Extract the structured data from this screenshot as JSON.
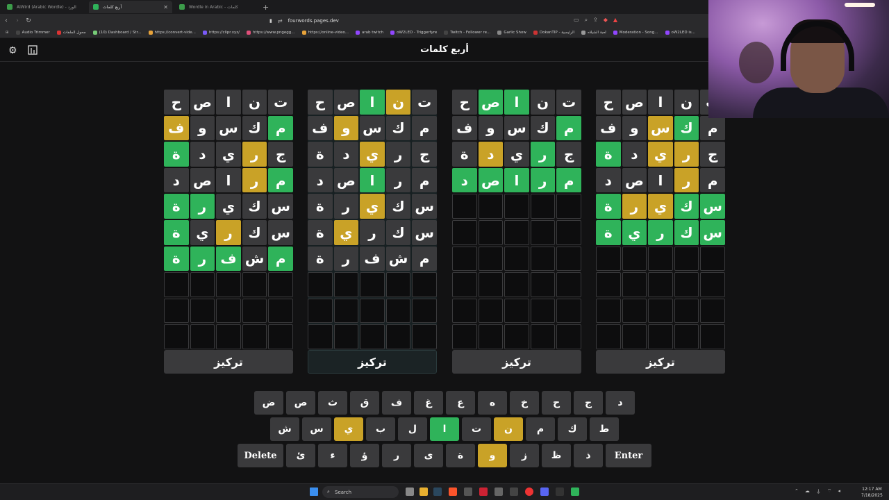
{
  "browser": {
    "tabs": [
      {
        "title": "AlWird (Arabic Wordle) - الورد"
      },
      {
        "title": "أربع كلمات",
        "active": true
      },
      {
        "title": "Wordle in Arabic - كلمات"
      }
    ],
    "url": "fourwords.pages.dev",
    "bookmarks": [
      "Audio Trimmer",
      "محول الملفات",
      "(10) Dashboard / Str...",
      "https://convert-vide...",
      "https://clipr.xyz/",
      "https://www.pngegg...",
      "https://online-video...",
      "arab twitch",
      "oW2LED - Triggerfyre",
      "Twitch - Follower re...",
      "Garlic Show",
      "DokanTIP - الرئيسية",
      "لعبة الشيلاه",
      "Moderation - Song...",
      "oW2LED is..."
    ]
  },
  "app": {
    "title": "أربع كلمات",
    "focus_label": "تركيز"
  },
  "colors": {
    "green": "#2fb35a",
    "yellow": "#c9a227",
    "dark": "#3a3a3c",
    "empty": "#0d0d0e"
  },
  "boards": [
    {
      "rows": [
        [
          {
            "l": "ح",
            "s": "d"
          },
          {
            "l": "ص",
            "s": "d"
          },
          {
            "l": "ا",
            "s": "d"
          },
          {
            "l": "ن",
            "s": "d"
          },
          {
            "l": "ت",
            "s": "d"
          }
        ],
        [
          {
            "l": "ف",
            "s": "y"
          },
          {
            "l": "و",
            "s": "d"
          },
          {
            "l": "س",
            "s": "d"
          },
          {
            "l": "ك",
            "s": "d"
          },
          {
            "l": "م",
            "s": "g"
          }
        ],
        [
          {
            "l": "ة",
            "s": "g"
          },
          {
            "l": "د",
            "s": "d"
          },
          {
            "l": "ي",
            "s": "d"
          },
          {
            "l": "ر",
            "s": "y"
          },
          {
            "l": "ج",
            "s": "d"
          }
        ],
        [
          {
            "l": "د",
            "s": "d"
          },
          {
            "l": "ص",
            "s": "d"
          },
          {
            "l": "ا",
            "s": "d"
          },
          {
            "l": "ر",
            "s": "y"
          },
          {
            "l": "م",
            "s": "g"
          }
        ],
        [
          {
            "l": "ة",
            "s": "g"
          },
          {
            "l": "ر",
            "s": "g"
          },
          {
            "l": "ي",
            "s": "d"
          },
          {
            "l": "ك",
            "s": "d"
          },
          {
            "l": "س",
            "s": "d"
          }
        ],
        [
          {
            "l": "ة",
            "s": "g"
          },
          {
            "l": "ي",
            "s": "d"
          },
          {
            "l": "ر",
            "s": "y"
          },
          {
            "l": "ك",
            "s": "d"
          },
          {
            "l": "س",
            "s": "d"
          }
        ],
        [
          {
            "l": "ة",
            "s": "g"
          },
          {
            "l": "ر",
            "s": "g"
          },
          {
            "l": "ف",
            "s": "g"
          },
          {
            "l": "ش",
            "s": "d"
          },
          {
            "l": "م",
            "s": "g"
          }
        ],
        [
          {
            "l": "",
            "s": "e"
          },
          {
            "l": "",
            "s": "e"
          },
          {
            "l": "",
            "s": "e"
          },
          {
            "l": "",
            "s": "e"
          },
          {
            "l": "",
            "s": "e"
          }
        ],
        [
          {
            "l": "",
            "s": "e"
          },
          {
            "l": "",
            "s": "e"
          },
          {
            "l": "",
            "s": "e"
          },
          {
            "l": "",
            "s": "e"
          },
          {
            "l": "",
            "s": "e"
          }
        ],
        [
          {
            "l": "",
            "s": "e"
          },
          {
            "l": "",
            "s": "e"
          },
          {
            "l": "",
            "s": "e"
          },
          {
            "l": "",
            "s": "e"
          },
          {
            "l": "",
            "s": "e"
          }
        ]
      ]
    },
    {
      "rows": [
        [
          {
            "l": "ح",
            "s": "d"
          },
          {
            "l": "ص",
            "s": "d"
          },
          {
            "l": "ا",
            "s": "g"
          },
          {
            "l": "ن",
            "s": "y"
          },
          {
            "l": "ت",
            "s": "d"
          }
        ],
        [
          {
            "l": "ف",
            "s": "d"
          },
          {
            "l": "و",
            "s": "y"
          },
          {
            "l": "س",
            "s": "d"
          },
          {
            "l": "ك",
            "s": "d"
          },
          {
            "l": "م",
            "s": "d"
          }
        ],
        [
          {
            "l": "ة",
            "s": "d"
          },
          {
            "l": "د",
            "s": "d"
          },
          {
            "l": "ي",
            "s": "y"
          },
          {
            "l": "ر",
            "s": "d"
          },
          {
            "l": "ج",
            "s": "d"
          }
        ],
        [
          {
            "l": "د",
            "s": "d"
          },
          {
            "l": "ص",
            "s": "d"
          },
          {
            "l": "ا",
            "s": "g"
          },
          {
            "l": "ر",
            "s": "d"
          },
          {
            "l": "م",
            "s": "d"
          }
        ],
        [
          {
            "l": "ة",
            "s": "d"
          },
          {
            "l": "ر",
            "s": "d"
          },
          {
            "l": "ي",
            "s": "y"
          },
          {
            "l": "ك",
            "s": "d"
          },
          {
            "l": "س",
            "s": "d"
          }
        ],
        [
          {
            "l": "ة",
            "s": "d"
          },
          {
            "l": "ي",
            "s": "y"
          },
          {
            "l": "ر",
            "s": "d"
          },
          {
            "l": "ك",
            "s": "d"
          },
          {
            "l": "س",
            "s": "d"
          }
        ],
        [
          {
            "l": "ة",
            "s": "d"
          },
          {
            "l": "ر",
            "s": "d"
          },
          {
            "l": "ف",
            "s": "d"
          },
          {
            "l": "ش",
            "s": "d"
          },
          {
            "l": "م",
            "s": "d"
          }
        ],
        [
          {
            "l": "",
            "s": "e"
          },
          {
            "l": "",
            "s": "e"
          },
          {
            "l": "",
            "s": "e"
          },
          {
            "l": "",
            "s": "e"
          },
          {
            "l": "",
            "s": "e"
          }
        ],
        [
          {
            "l": "",
            "s": "e"
          },
          {
            "l": "",
            "s": "e"
          },
          {
            "l": "",
            "s": "e"
          },
          {
            "l": "",
            "s": "e"
          },
          {
            "l": "",
            "s": "e"
          }
        ],
        [
          {
            "l": "",
            "s": "e"
          },
          {
            "l": "",
            "s": "e"
          },
          {
            "l": "",
            "s": "e"
          },
          {
            "l": "",
            "s": "e"
          },
          {
            "l": "",
            "s": "e"
          }
        ]
      ]
    },
    {
      "rows": [
        [
          {
            "l": "ح",
            "s": "d"
          },
          {
            "l": "ص",
            "s": "g"
          },
          {
            "l": "ا",
            "s": "g"
          },
          {
            "l": "ن",
            "s": "d"
          },
          {
            "l": "ت",
            "s": "d"
          }
        ],
        [
          {
            "l": "ف",
            "s": "d"
          },
          {
            "l": "و",
            "s": "d"
          },
          {
            "l": "س",
            "s": "d"
          },
          {
            "l": "ك",
            "s": "d"
          },
          {
            "l": "م",
            "s": "g"
          }
        ],
        [
          {
            "l": "ة",
            "s": "d"
          },
          {
            "l": "د",
            "s": "y"
          },
          {
            "l": "ي",
            "s": "d"
          },
          {
            "l": "ر",
            "s": "g"
          },
          {
            "l": "ج",
            "s": "d"
          }
        ],
        [
          {
            "l": "د",
            "s": "g"
          },
          {
            "l": "ص",
            "s": "g"
          },
          {
            "l": "ا",
            "s": "g"
          },
          {
            "l": "ر",
            "s": "g"
          },
          {
            "l": "م",
            "s": "g"
          }
        ],
        [
          {
            "l": "",
            "s": "e"
          },
          {
            "l": "",
            "s": "e"
          },
          {
            "l": "",
            "s": "e"
          },
          {
            "l": "",
            "s": "e"
          },
          {
            "l": "",
            "s": "e"
          }
        ],
        [
          {
            "l": "",
            "s": "e"
          },
          {
            "l": "",
            "s": "e"
          },
          {
            "l": "",
            "s": "e"
          },
          {
            "l": "",
            "s": "e"
          },
          {
            "l": "",
            "s": "e"
          }
        ],
        [
          {
            "l": "",
            "s": "e"
          },
          {
            "l": "",
            "s": "e"
          },
          {
            "l": "",
            "s": "e"
          },
          {
            "l": "",
            "s": "e"
          },
          {
            "l": "",
            "s": "e"
          }
        ],
        [
          {
            "l": "",
            "s": "e"
          },
          {
            "l": "",
            "s": "e"
          },
          {
            "l": "",
            "s": "e"
          },
          {
            "l": "",
            "s": "e"
          },
          {
            "l": "",
            "s": "e"
          }
        ],
        [
          {
            "l": "",
            "s": "e"
          },
          {
            "l": "",
            "s": "e"
          },
          {
            "l": "",
            "s": "e"
          },
          {
            "l": "",
            "s": "e"
          },
          {
            "l": "",
            "s": "e"
          }
        ],
        [
          {
            "l": "",
            "s": "e"
          },
          {
            "l": "",
            "s": "e"
          },
          {
            "l": "",
            "s": "e"
          },
          {
            "l": "",
            "s": "e"
          },
          {
            "l": "",
            "s": "e"
          }
        ]
      ]
    },
    {
      "rows": [
        [
          {
            "l": "ح",
            "s": "d"
          },
          {
            "l": "ص",
            "s": "d"
          },
          {
            "l": "ا",
            "s": "d"
          },
          {
            "l": "ن",
            "s": "d"
          },
          {
            "l": "ت",
            "s": "d"
          }
        ],
        [
          {
            "l": "ف",
            "s": "d"
          },
          {
            "l": "و",
            "s": "d"
          },
          {
            "l": "س",
            "s": "y"
          },
          {
            "l": "ك",
            "s": "g"
          },
          {
            "l": "م",
            "s": "d"
          }
        ],
        [
          {
            "l": "ة",
            "s": "g"
          },
          {
            "l": "د",
            "s": "d"
          },
          {
            "l": "ي",
            "s": "y"
          },
          {
            "l": "ر",
            "s": "y"
          },
          {
            "l": "ج",
            "s": "d"
          }
        ],
        [
          {
            "l": "د",
            "s": "d"
          },
          {
            "l": "ص",
            "s": "d"
          },
          {
            "l": "ا",
            "s": "d"
          },
          {
            "l": "ر",
            "s": "y"
          },
          {
            "l": "م",
            "s": "d"
          }
        ],
        [
          {
            "l": "ة",
            "s": "g"
          },
          {
            "l": "ر",
            "s": "y"
          },
          {
            "l": "ي",
            "s": "y"
          },
          {
            "l": "ك",
            "s": "g"
          },
          {
            "l": "س",
            "s": "g"
          }
        ],
        [
          {
            "l": "ة",
            "s": "g"
          },
          {
            "l": "ي",
            "s": "g"
          },
          {
            "l": "ر",
            "s": "g"
          },
          {
            "l": "ك",
            "s": "g"
          },
          {
            "l": "س",
            "s": "g"
          }
        ],
        [
          {
            "l": "",
            "s": "e"
          },
          {
            "l": "",
            "s": "e"
          },
          {
            "l": "",
            "s": "e"
          },
          {
            "l": "",
            "s": "e"
          },
          {
            "l": "",
            "s": "e"
          }
        ],
        [
          {
            "l": "",
            "s": "e"
          },
          {
            "l": "",
            "s": "e"
          },
          {
            "l": "",
            "s": "e"
          },
          {
            "l": "",
            "s": "e"
          },
          {
            "l": "",
            "s": "e"
          }
        ],
        [
          {
            "l": "",
            "s": "e"
          },
          {
            "l": "",
            "s": "e"
          },
          {
            "l": "",
            "s": "e"
          },
          {
            "l": "",
            "s": "e"
          },
          {
            "l": "",
            "s": "e"
          }
        ],
        [
          {
            "l": "",
            "s": "e"
          },
          {
            "l": "",
            "s": "e"
          },
          {
            "l": "",
            "s": "e"
          },
          {
            "l": "",
            "s": "e"
          },
          {
            "l": "",
            "s": "e"
          }
        ]
      ]
    }
  ],
  "keyboard": [
    [
      {
        "k": "ض",
        "s": "d"
      },
      {
        "k": "ص",
        "s": "d"
      },
      {
        "k": "ث",
        "s": "d"
      },
      {
        "k": "ق",
        "s": "d"
      },
      {
        "k": "ف",
        "s": "d"
      },
      {
        "k": "غ",
        "s": "d"
      },
      {
        "k": "ع",
        "s": "d"
      },
      {
        "k": "ه",
        "s": "d"
      },
      {
        "k": "خ",
        "s": "d"
      },
      {
        "k": "ح",
        "s": "d"
      },
      {
        "k": "ج",
        "s": "d"
      },
      {
        "k": "د",
        "s": "d"
      }
    ],
    [
      {
        "k": "ش",
        "s": "d"
      },
      {
        "k": "س",
        "s": "d"
      },
      {
        "k": "ي",
        "s": "y"
      },
      {
        "k": "ب",
        "s": "d"
      },
      {
        "k": "ل",
        "s": "d"
      },
      {
        "k": "ا",
        "s": "g"
      },
      {
        "k": "ت",
        "s": "d"
      },
      {
        "k": "ن",
        "s": "y"
      },
      {
        "k": "م",
        "s": "d"
      },
      {
        "k": "ك",
        "s": "d"
      },
      {
        "k": "ط",
        "s": "d"
      }
    ],
    [
      {
        "k": "Delete",
        "s": "d",
        "wide": true
      },
      {
        "k": "ئ",
        "s": "d"
      },
      {
        "k": "ء",
        "s": "d"
      },
      {
        "k": "ؤ",
        "s": "d"
      },
      {
        "k": "ر",
        "s": "d"
      },
      {
        "k": "ى",
        "s": "d"
      },
      {
        "k": "ة",
        "s": "d"
      },
      {
        "k": "و",
        "s": "y"
      },
      {
        "k": "ز",
        "s": "d"
      },
      {
        "k": "ظ",
        "s": "d"
      },
      {
        "k": "ذ",
        "s": "d"
      },
      {
        "k": "Enter",
        "s": "d",
        "wide": true
      }
    ]
  ],
  "taskbar": {
    "search_placeholder": "Search",
    "time": "12:17 AM",
    "date": "7/18/2025"
  }
}
